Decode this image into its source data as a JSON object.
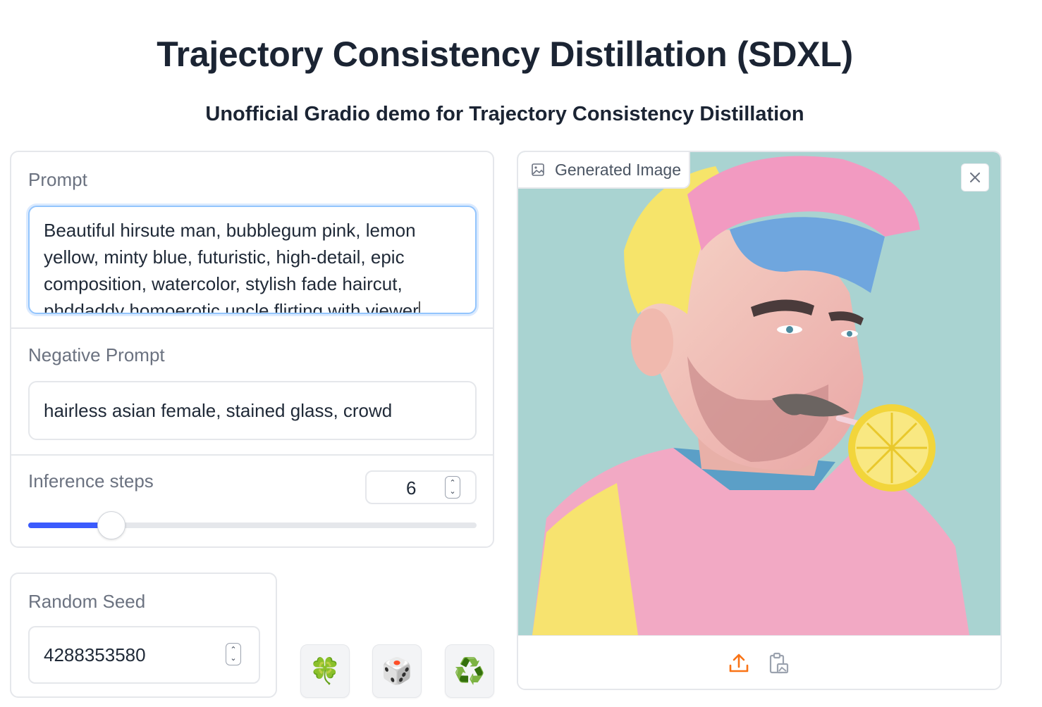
{
  "header": {
    "title": "Trajectory Consistency Distillation (SDXL)",
    "subtitle": "Unofficial Gradio demo for Trajectory Consistency Distillation"
  },
  "prompt": {
    "label": "Prompt",
    "value": "Beautiful hirsute man, bubblegum pink, lemon yellow, minty blue, futuristic, high-detail, epic composition, watercolor, stylish fade haircut, phddaddy homoerotic uncle flirting with viewer"
  },
  "negative_prompt": {
    "label": "Negative Prompt",
    "value": "hairless asian female, stained glass, crowd"
  },
  "inference_steps": {
    "label": "Inference steps",
    "value": "6",
    "slider_fraction": 0.186
  },
  "seed": {
    "label": "Random Seed",
    "value": "4288353580"
  },
  "buttons": {
    "clover": "🍀",
    "dice": "🎲",
    "recycle": "♻️"
  },
  "output": {
    "label": "Generated Image"
  },
  "colors": {
    "accent": "#3b5bfd",
    "upload_icon": "#f97316"
  }
}
